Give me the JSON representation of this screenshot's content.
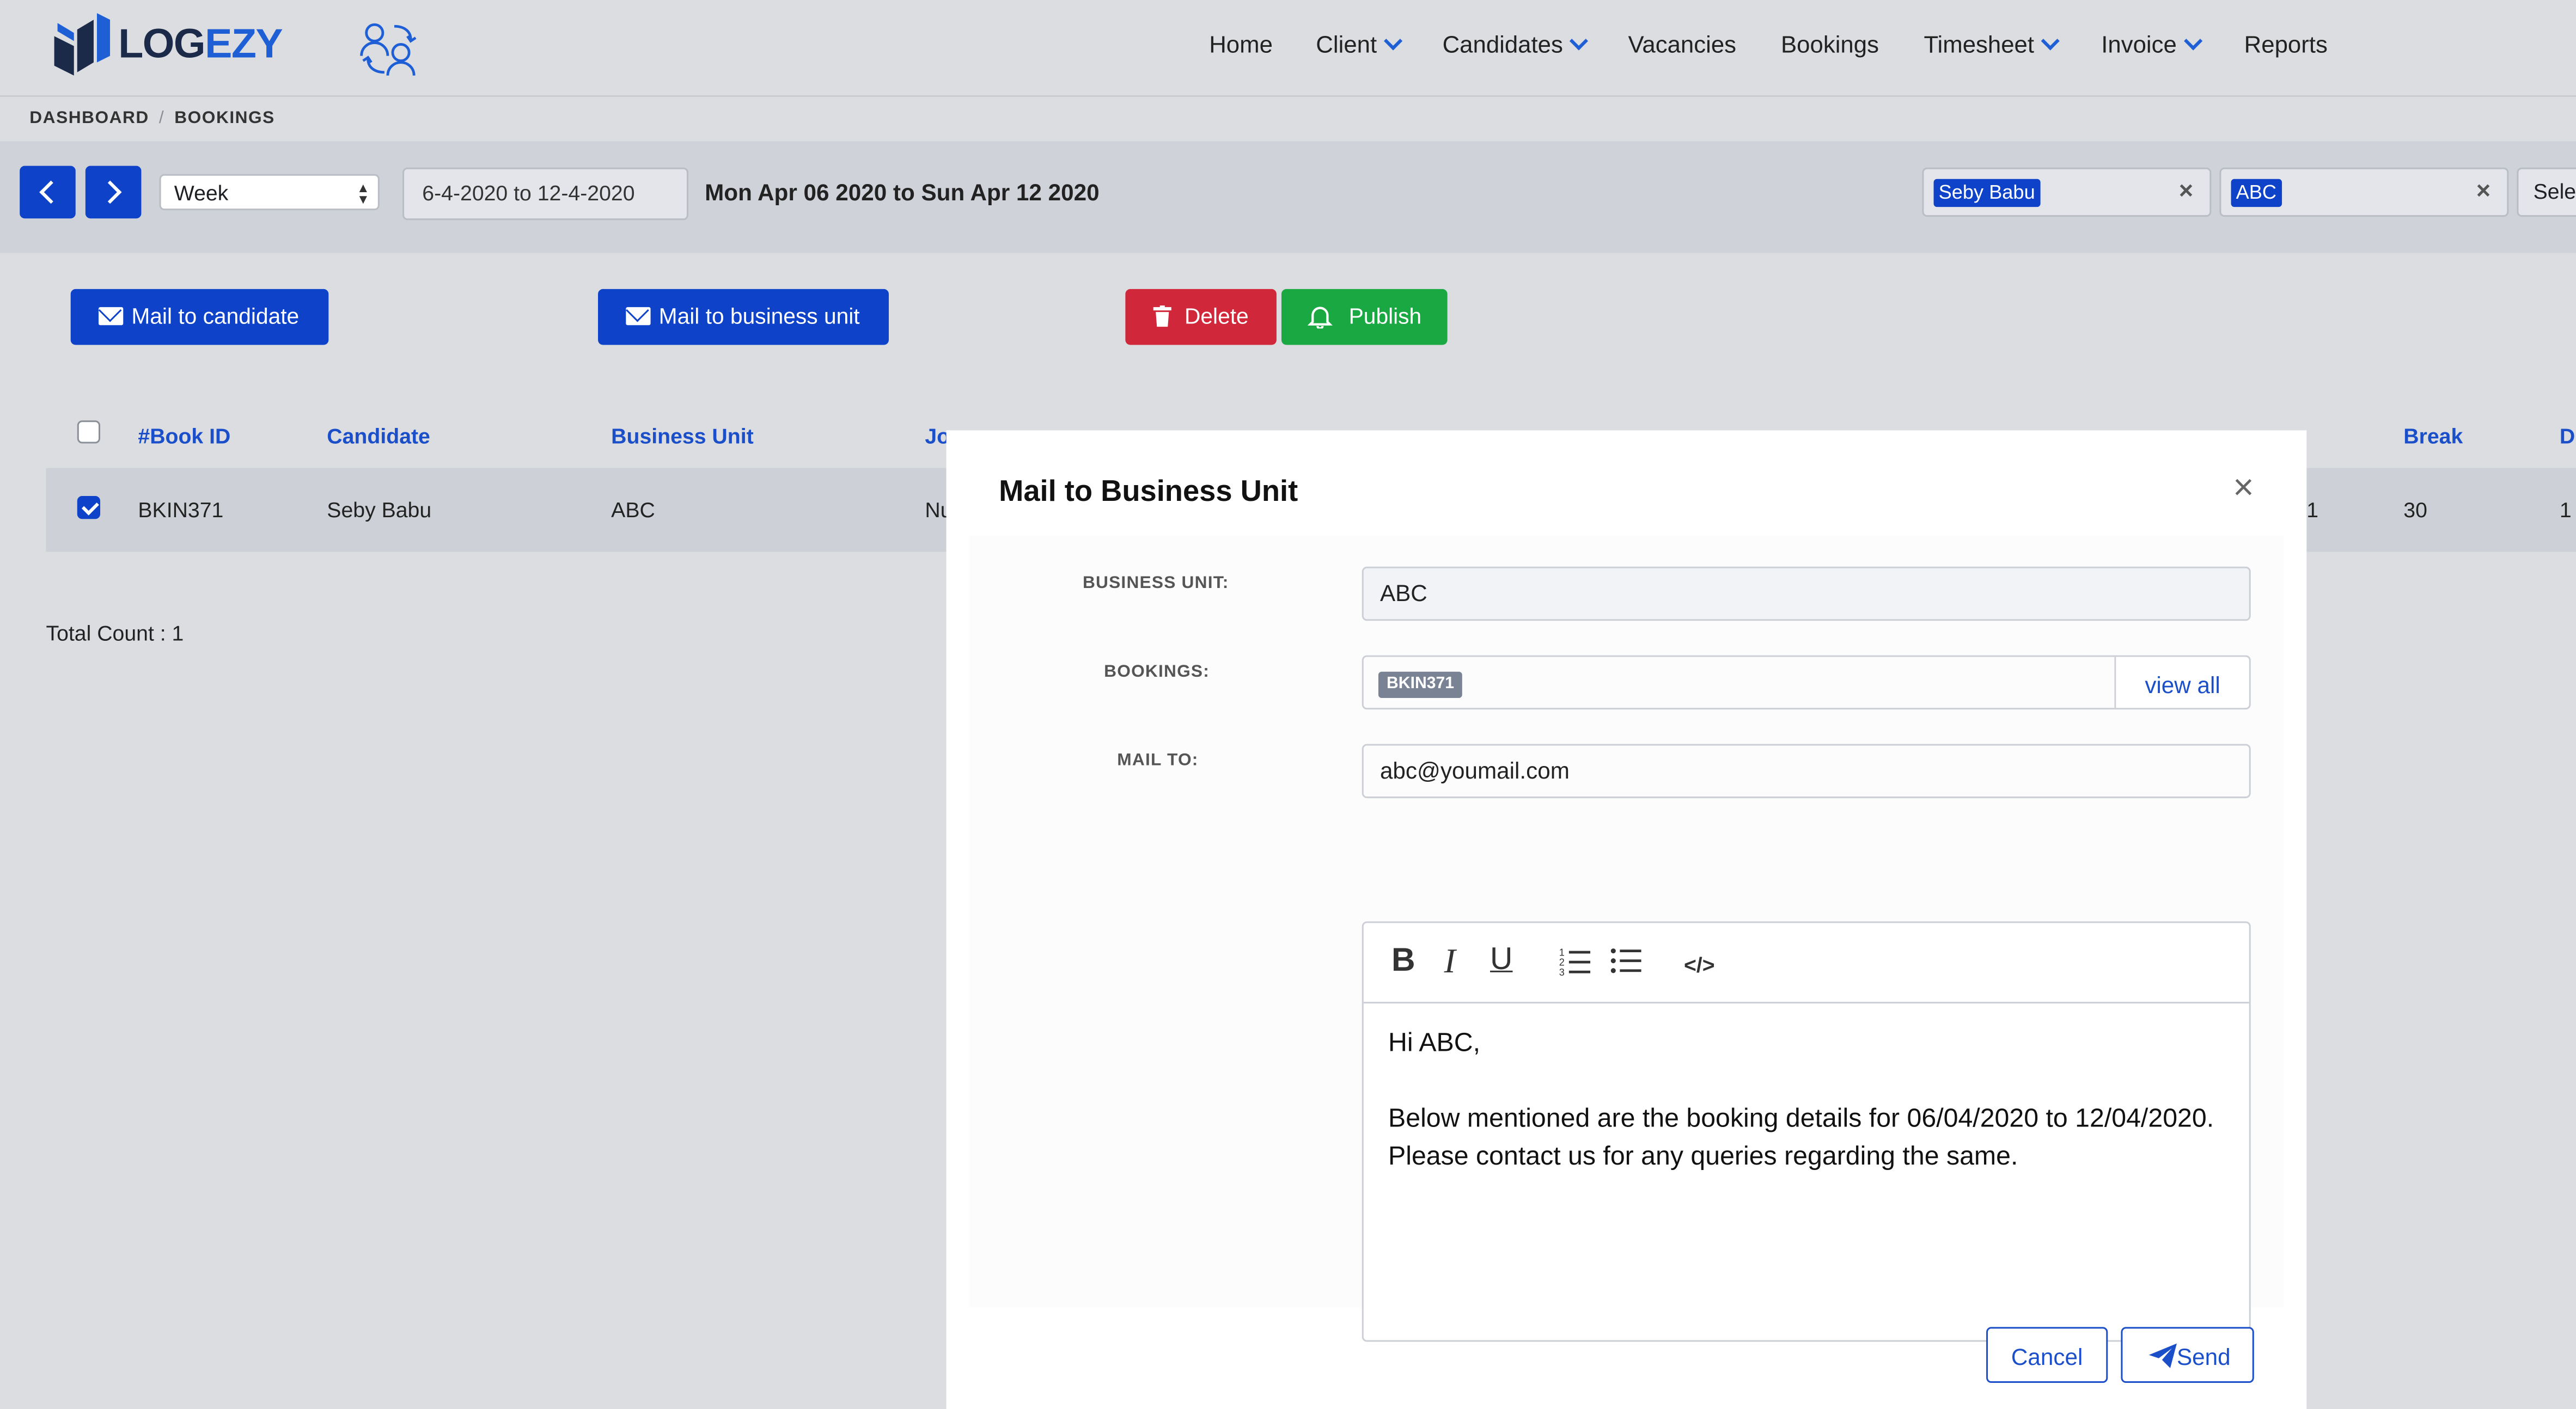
{
  "brand": {
    "logo_part1": "LOG",
    "logo_part2": "EZY"
  },
  "nav": {
    "home": "Home",
    "client": "Client",
    "candidates": "Candidates",
    "vacancies": "Vacancies",
    "bookings": "Bookings",
    "timesheet": "Timesheet",
    "invoice": "Invoice",
    "reports": "Reports"
  },
  "breadcrumb": {
    "dashboard": "DASHBOARD",
    "separator": "/",
    "current": "BOOKINGS"
  },
  "toolbar": {
    "period_select": "Week",
    "date_range": "6-4-2020 to 12-4-2020",
    "date_label": "Mon Apr 06 2020 to Sun Apr 12 2020",
    "filter_candidate": "Seby Babu",
    "filter_business_unit": "ABC",
    "select_cut": "Sele",
    "clear_symbol": "×"
  },
  "actions": {
    "mail_candidate": "Mail to candidate",
    "mail_business_unit": "Mail to business unit",
    "delete": "Delete",
    "publish": "Publish"
  },
  "table": {
    "headers": {
      "book_id": "#Book ID",
      "candidate": "Candidate",
      "business_unit": "Business Unit",
      "job_title_cut": "Jo",
      "break": "Break",
      "last_cut": "D"
    },
    "row": {
      "book_id": "BKIN371",
      "candidate": "Seby Babu",
      "business_unit": "ABC",
      "job_title_cut": "Nu",
      "end_cut": "1",
      "break": "30",
      "last_cut": "1"
    }
  },
  "total_count": "Total Count : 1",
  "modal": {
    "title": "Mail to Business Unit",
    "close": "×",
    "business_unit_label": "BUSINESS UNIT:",
    "business_unit_value": "ABC",
    "bookings_label": "BOOKINGS:",
    "booking_tag": "BKIN371",
    "view_all": "view all",
    "mail_to_label": "MAIL TO:",
    "mail_to_value": "abc@youmail.com",
    "toolbar": {
      "bold": "B",
      "italic": "I",
      "underline": "U",
      "code": "</>"
    },
    "body_line1": "Hi ABC,",
    "body_line2": "Below mentioned are the booking details for 06/04/2020 to 12/04/2020. Please contact us for any queries regarding the same.",
    "cancel": "Cancel",
    "send": "Send"
  },
  "colors": {
    "primary": "#0e43c9",
    "danger": "#d0283a",
    "success": "#1aa843",
    "background": "#dcdde1"
  }
}
